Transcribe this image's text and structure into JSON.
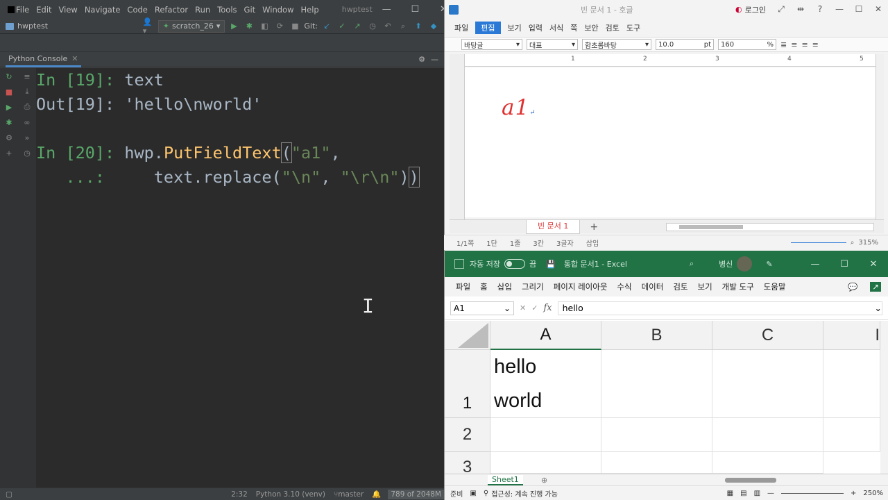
{
  "pycharm": {
    "menu": [
      "File",
      "Edit",
      "View",
      "Navigate",
      "Code",
      "Refactor",
      "Run",
      "Tools",
      "Git",
      "Window",
      "Help"
    ],
    "project_title": "hwptest",
    "breadcrumb": "hwptest",
    "run_config": "scratch_26",
    "git_label": "Git:",
    "panel_title": "Python Console",
    "console": {
      "l1_prompt": "In [19]: ",
      "l1_code": "text",
      "l2_prompt": "Out[19]: ",
      "l2_value": "'hello\\nworld'",
      "l3_prompt": "In [20]: ",
      "l3_obj": "hwp.",
      "l3_fn": "PutFieldText",
      "l3_open": "(",
      "l3_str": "\"a1\"",
      "l3_comma": ",",
      "l4_prompt": "   ...: ",
      "l4_code": "    text.replace(",
      "l4_s1": "\"\\n\"",
      "l4_sep": ", ",
      "l4_s2": "\"\\r\\n\"",
      "l4_close1": ")",
      "l4_close2": ")"
    },
    "status": {
      "position": "2:32",
      "interpreter": "Python 3.10 (venv)",
      "branch": "master",
      "memory": "789 of 2048M"
    }
  },
  "hwp": {
    "doc_title": "빈 문서 1 - 호글",
    "login": "로그인",
    "menu": [
      "파일",
      "편집",
      "보기",
      "입력",
      "서식",
      "쪽",
      "보안",
      "검토",
      "도구"
    ],
    "active_menu": "편집",
    "style": "바탕글",
    "lang": "대표",
    "font": "함초롬바탕",
    "size": "10.0",
    "size_unit": "pt",
    "line_spacing": "160",
    "line_unit": "%",
    "ruler": [
      "1",
      "2",
      "3",
      "4",
      "5"
    ],
    "field_text": "a1",
    "return_mark": "↵",
    "sheet_tab": "빈 문서 1",
    "status": [
      "1/1쪽",
      "1단",
      "1줄",
      "3칸",
      "3글자",
      "삽입"
    ],
    "zoom": "315%"
  },
  "excel": {
    "autosave": "자동 저장",
    "autosave_state": "끔",
    "doc_title": "통합 문서1 - Excel",
    "user": "병신",
    "ribbon": [
      "파일",
      "홈",
      "삽입",
      "그리기",
      "페이지 레이아웃",
      "수식",
      "데이터",
      "검토",
      "보기",
      "개발 도구",
      "도움말"
    ],
    "name_box": "A1",
    "fx": "fx",
    "formula": "hello",
    "columns": [
      "A",
      "B",
      "C",
      "I"
    ],
    "rows": [
      "1",
      "2",
      "3"
    ],
    "cell_a1_line1": "hello",
    "cell_a1_line2": "world",
    "sheet": "Sheet1",
    "status_ready": "준비",
    "accessibility": "접근성: 계속 진행 가능",
    "zoom": "250%"
  }
}
